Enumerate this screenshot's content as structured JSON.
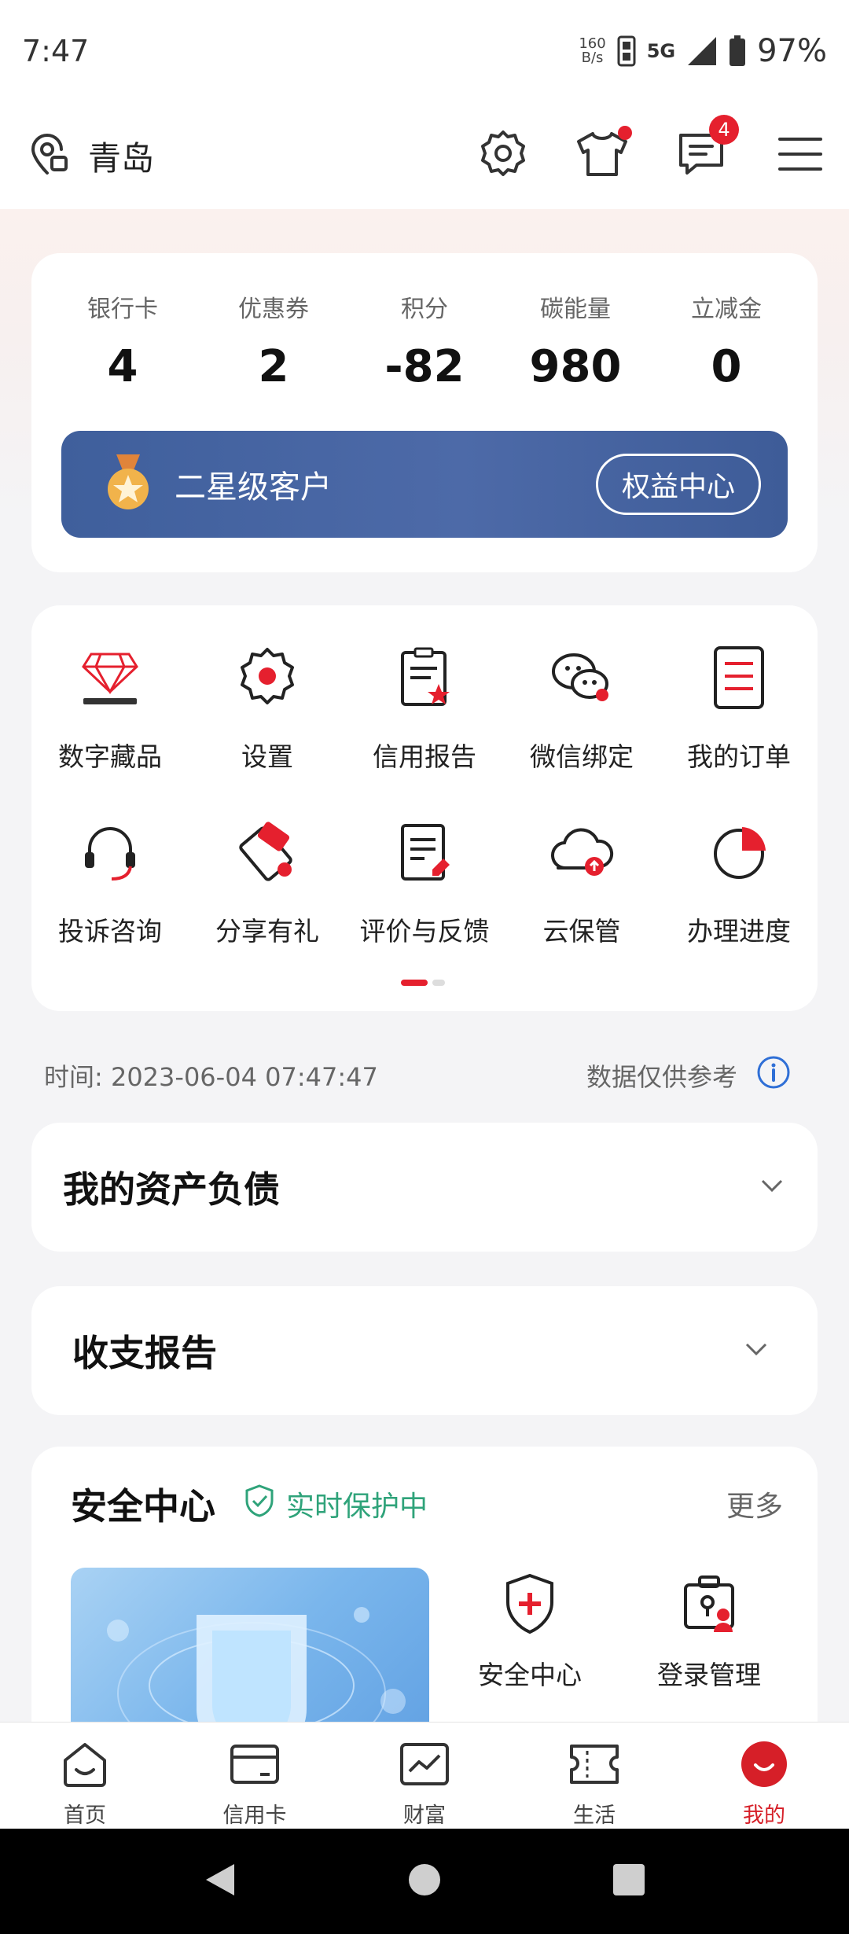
{
  "status_bar": {
    "time": "7:47",
    "net_speed_top": "160",
    "net_speed_bottom": "B/s",
    "network": "5G",
    "battery": "97%"
  },
  "header": {
    "city": "青岛",
    "message_count": "4"
  },
  "summary": {
    "stats": [
      {
        "label": "银行卡",
        "value": "4"
      },
      {
        "label": "优惠券",
        "value": "2"
      },
      {
        "label": "积分",
        "value": "-82"
      },
      {
        "label": "碳能量",
        "value": "980"
      },
      {
        "label": "立减金",
        "value": "0"
      }
    ],
    "tier": "二星级客户",
    "benefit_button": "权益中心"
  },
  "services": [
    {
      "label": "数字藏品",
      "icon": "gem-icon"
    },
    {
      "label": "设置",
      "icon": "gear-icon"
    },
    {
      "label": "信用报告",
      "icon": "credit-report-icon"
    },
    {
      "label": "微信绑定",
      "icon": "wechat-icon"
    },
    {
      "label": "我的订单",
      "icon": "order-icon"
    },
    {
      "label": "投诉咨询",
      "icon": "headset-icon"
    },
    {
      "label": "分享有礼",
      "icon": "gift-card-icon"
    },
    {
      "label": "评价与反馈",
      "icon": "feedback-icon"
    },
    {
      "label": "云保管",
      "icon": "cloud-upload-icon"
    },
    {
      "label": "办理进度",
      "icon": "progress-pie-icon"
    }
  ],
  "timeline": {
    "time_text": "时间: 2023-06-04 07:47:47",
    "note": "数据仅供参考"
  },
  "sections": {
    "assets": "我的资产负债",
    "income": "收支报告"
  },
  "security": {
    "title": "安全中心",
    "status": "实时保护中",
    "more": "更多",
    "items": [
      {
        "label": "安全中心",
        "icon": "shield-plus-icon"
      },
      {
        "label": "登录管理",
        "icon": "login-manage-icon"
      }
    ]
  },
  "tabs": [
    {
      "label": "首页",
      "icon": "home-icon"
    },
    {
      "label": "信用卡",
      "icon": "credit-card-icon"
    },
    {
      "label": "财富",
      "icon": "wealth-chart-icon"
    },
    {
      "label": "生活",
      "icon": "ticket-icon"
    },
    {
      "label": "我的",
      "icon": "profile-icon",
      "active": true
    }
  ],
  "colors": {
    "accent": "#e5202e",
    "vip_bar": "#4d6aa8",
    "secure": "#2fa37a"
  }
}
